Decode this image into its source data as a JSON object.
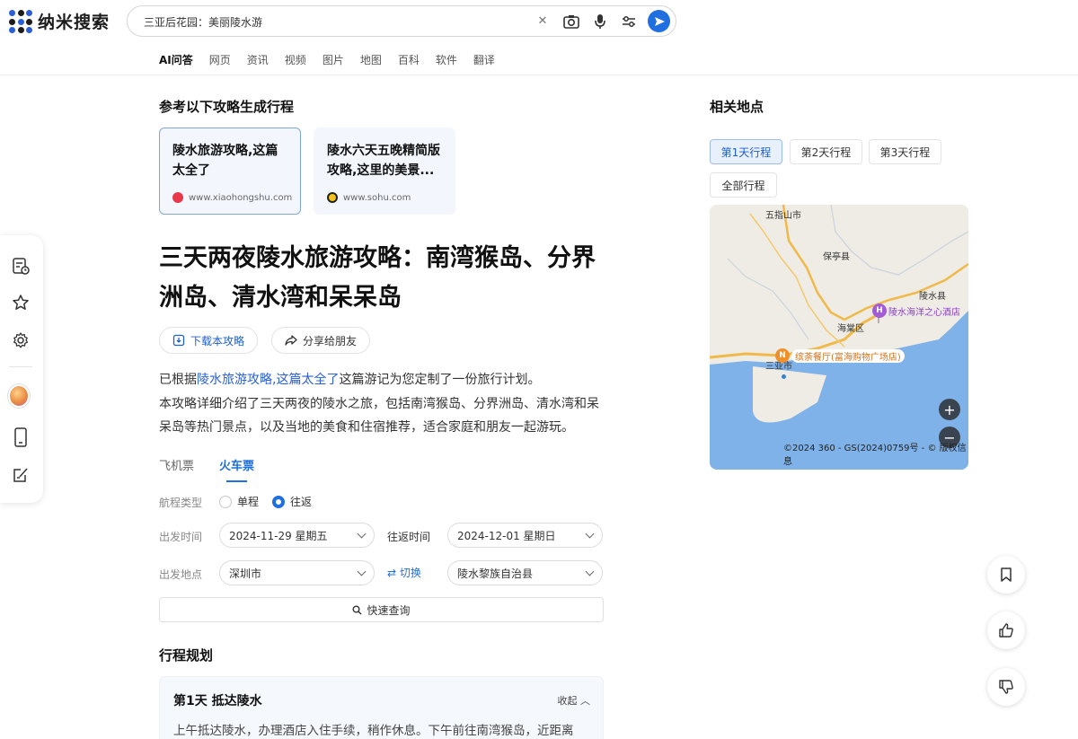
{
  "app": {
    "name": "纳米搜索"
  },
  "search": {
    "query": "三亚后花园：美丽陵水游"
  },
  "tabs": [
    "AI问答",
    "网页",
    "资讯",
    "视频",
    "图片",
    "地图",
    "百科",
    "软件",
    "翻译"
  ],
  "references": {
    "title": "参考以下攻略生成行程",
    "cards": [
      {
        "title": "陵水旅游攻略,这篇太全了",
        "source": "www.xiaohongshu.com"
      },
      {
        "title": "陵水六天五晚精简版攻略,这里的美景...",
        "source": "www.sohu.com"
      }
    ]
  },
  "article": {
    "title": "三天两夜陵水旅游攻略：南湾猴岛、分界洲岛、清水湾和呆呆岛",
    "download_label": "下载本攻略",
    "share_label": "分享给朋友",
    "summary_prefix": "已根据",
    "summary_link": "陵水旅游攻略,这篇太全了",
    "summary_suffix": "这篇游记为您定制了一份旅行计划。",
    "summary_body": "本攻略详细介绍了三天两夜的陵水之旅，包括南湾猴岛、分界洲岛、清水湾和呆呆岛等热门景点，以及当地的美食和住宿推荐，适合家庭和朋友一起游玩。"
  },
  "ticket": {
    "tabs": [
      "飞机票",
      "火车票"
    ],
    "trip_type_label": "航程类型",
    "one_way": "单程",
    "round_trip": "往返",
    "depart_time_label": "出发时间",
    "depart_date": "2024-11-29 星期五",
    "return_time_label": "往返时间",
    "return_date": "2024-12-01 星期日",
    "depart_place_label": "出发地点",
    "depart_city": "深圳市",
    "swap_label": "⇄ 切换",
    "dest_city": "陵水黎族自治县",
    "query_label": "快速查询"
  },
  "itinerary": {
    "title": "行程规划",
    "day1_title": "第1天 抵达陵水",
    "collapse_label": "收起",
    "day1_text": "上午抵达陵水，办理酒店入住手续，稍作休息。下午前往南湾猴岛，近距离"
  },
  "places": {
    "title": "相关地点",
    "day_buttons": [
      "第1天行程",
      "第2天行程",
      "第3天行程",
      "全部行程"
    ],
    "map_labels": [
      "五指山市",
      "保亭县",
      "陵水县",
      "海棠区",
      "三亚市"
    ],
    "poi_hotel": "陵水海洋之心酒店",
    "poi_restaurant": "缤荼餐厅(富海购物广场店)",
    "copyright": "©2024 360 - GS(2024)0759号 - © 版权信息"
  },
  "colors": {
    "accent": "#1f6fe0",
    "link": "#2a5fd8",
    "map_sea": "#7fb2e8",
    "road": "#f0b94a"
  }
}
